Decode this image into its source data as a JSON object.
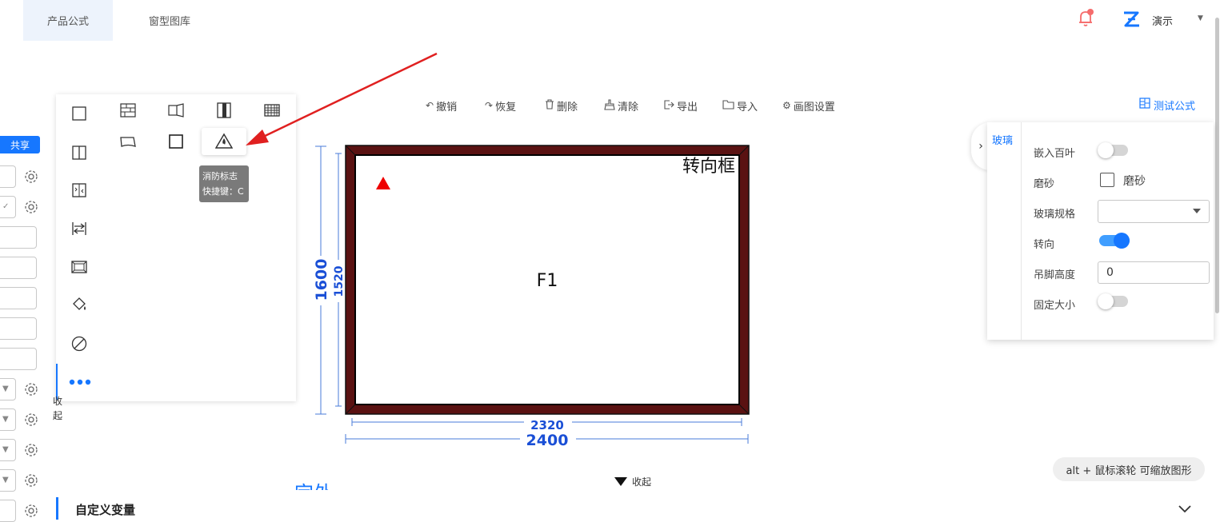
{
  "nav": {
    "tabs": [
      {
        "label": "产品公式",
        "active": true
      },
      {
        "label": "窗型图库",
        "active": false
      }
    ],
    "user": {
      "name": "演示"
    },
    "notification_dot_color": "#f56c6c"
  },
  "left_fragment": {
    "share_label": "共享"
  },
  "tools_panel": {
    "tooltip": {
      "title": "消防标志",
      "shortcut": "快捷键：C"
    },
    "collapse_label": "收起"
  },
  "toolbar": {
    "undo": "撤销",
    "redo": "恢复",
    "delete": "删除",
    "clear": "清除",
    "export": "导出",
    "import": "导入",
    "settings": "画图设置",
    "test_formula": "测试公式"
  },
  "canvas": {
    "frame_label": "转向框",
    "sash_label": "F1",
    "dim_outer_width": "2400",
    "dim_inner_width": "2320",
    "dim_outer_height": "1600",
    "dim_inner_height": "1520",
    "frame_color": "#5a1212",
    "dimension_color": "#1a4fd6"
  },
  "props_panel": {
    "tab": "玻璃",
    "fields": {
      "embed_louver": {
        "label": "嵌入百叶",
        "on": false
      },
      "frosted": {
        "label": "磨砂",
        "checkbox_label": "磨砂",
        "checked": false
      },
      "glass_spec": {
        "label": "玻璃规格",
        "value": ""
      },
      "turn": {
        "label": "转向",
        "on": true
      },
      "hang_height": {
        "label": "吊脚高度",
        "value": "0"
      },
      "fixed_size": {
        "label": "固定大小",
        "on": false
      }
    }
  },
  "hint": "alt + 鼠标滚轮 可缩放图形",
  "bottom": {
    "collapse_label": "收起",
    "partial_heading": "定外",
    "section_title": "自定义变量"
  },
  "accent_color": "#1677ff"
}
